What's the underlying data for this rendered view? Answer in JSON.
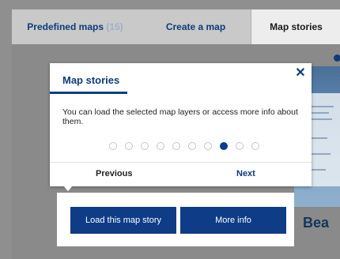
{
  "tabs": {
    "predefined_label": "Predefined maps",
    "predefined_count": "(15)",
    "create_label": "Create a map",
    "stories_label": "Map stories"
  },
  "popover": {
    "title": "Map stories",
    "body": "You can load the selected map layers or access more info about them.",
    "close_icon": "close-icon",
    "steps_total": 10,
    "active_step": 8,
    "previous_label": "Previous",
    "next_label": "Next"
  },
  "actions": {
    "load_label": "Load this map story",
    "more_info_label": "More info"
  },
  "story_card": {
    "title_partial": "Bea"
  },
  "colors": {
    "accent": "#0e3c86",
    "tab_text": "#0e3c79",
    "overlay": "#8a8a8a"
  }
}
